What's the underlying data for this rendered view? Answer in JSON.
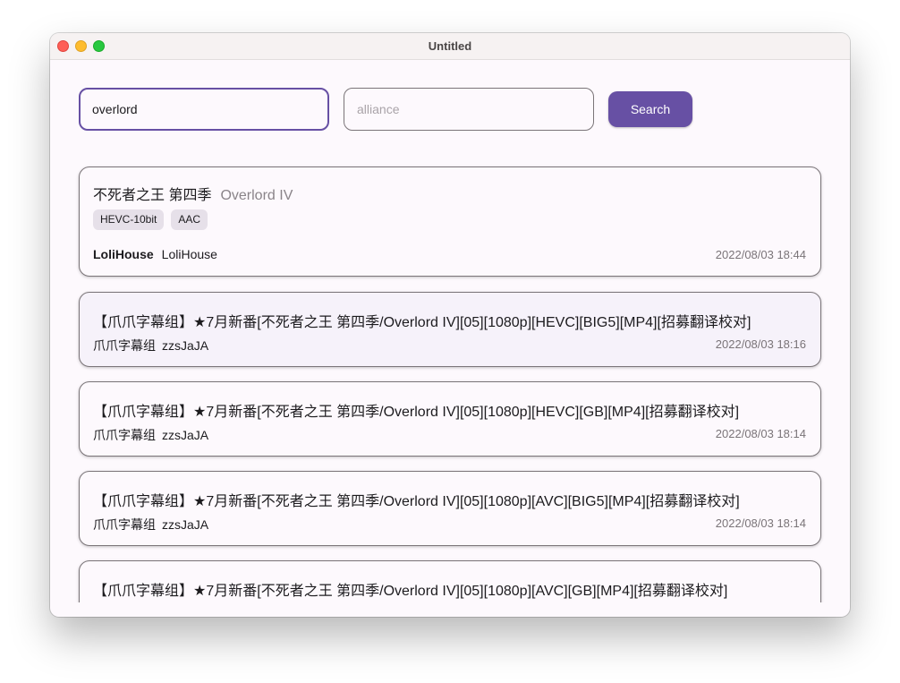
{
  "window": {
    "title": "Untitled"
  },
  "search": {
    "keyword_value": "overlord",
    "alliance_placeholder": "alliance",
    "button_label": "Search"
  },
  "featured": {
    "title": "不死者之王 第四季",
    "subtitle": "Overlord IV",
    "tags": [
      "HEVC-10bit",
      "AAC"
    ],
    "group": "LoliHouse",
    "uploader": "LoliHouse",
    "date": "2022/08/03 18:44"
  },
  "results": [
    {
      "title": "【爪爪字幕组】★7月新番[不死者之王 第四季/Overlord IV][05][1080p][HEVC][BIG5][MP4][招募翻译校对]",
      "group": "爪爪字幕组",
      "uploader": "zzsJaJA",
      "date": "2022/08/03 18:16"
    },
    {
      "title": "【爪爪字幕组】★7月新番[不死者之王 第四季/Overlord IV][05][1080p][HEVC][GB][MP4][招募翻译校对]",
      "group": "爪爪字幕组",
      "uploader": "zzsJaJA",
      "date": "2022/08/03 18:14"
    },
    {
      "title": "【爪爪字幕组】★7月新番[不死者之王 第四季/Overlord IV][05][1080p][AVC][BIG5][MP4][招募翻译校对]",
      "group": "爪爪字幕组",
      "uploader": "zzsJaJA",
      "date": "2022/08/03 18:14"
    },
    {
      "title": "【爪爪字幕组】★7月新番[不死者之王 第四季/Overlord IV][05][1080p][AVC][GB][MP4][招募翻译校对]",
      "group": "",
      "uploader": "",
      "date": ""
    }
  ]
}
